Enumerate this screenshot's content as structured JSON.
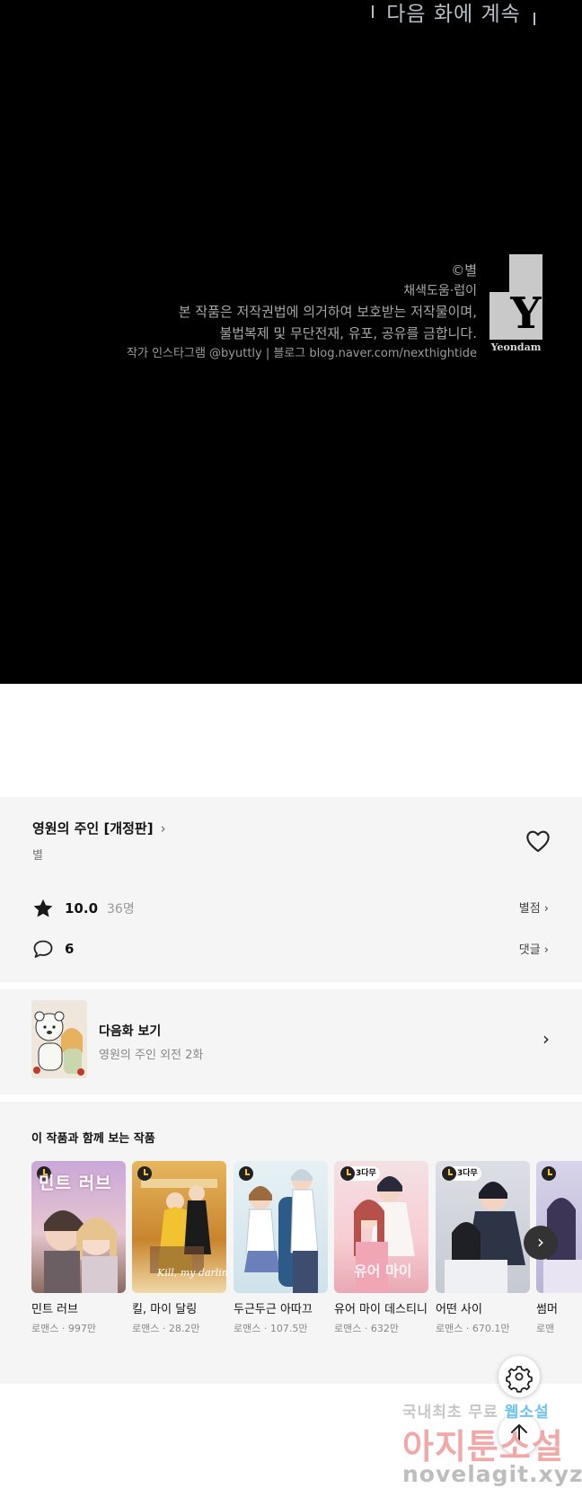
{
  "panel": {
    "next_caption": "다음 화에 계속",
    "credits": {
      "copyright": "©별",
      "assist": "채색도움·럽이",
      "notice_line1": "본 작품은 저작권법에 의거하여 보호받는 저작물이며,",
      "notice_line2": "불법복제 및 무단전재, 유포, 공유를 금합니다.",
      "sns_line": "작가 인스타그램  @byuttly | 블로그  blog.naver.com/nexthightide"
    },
    "logo_text": "Yeondam"
  },
  "work": {
    "title": "영원의 주인 [개정판]",
    "author": "별",
    "rating": "10.0",
    "rating_count": "36명",
    "rate_link": "별점",
    "comment_count": "6",
    "comment_link": "댓글"
  },
  "next_episode": {
    "label": "다음화 보기",
    "subtitle": "영원의 주인 외전 2화"
  },
  "recommendations": {
    "title": "이 작품과 함께 보는 작품",
    "items": [
      {
        "name": "민트 러브",
        "meta": "로맨스 · 997만",
        "cover_title": "민트 러브",
        "badge": ""
      },
      {
        "name": "킬, 마이 달링",
        "meta": "로맨스 · 28.2만",
        "cover_title": "",
        "badge": ""
      },
      {
        "name": "두근두근 아따끄",
        "meta": "로맨스 · 107.5만",
        "cover_title": "",
        "badge": ""
      },
      {
        "name": "유어 마이 데스티니",
        "meta": "로맨스 · 632만",
        "cover_title": "",
        "badge": "3다무"
      },
      {
        "name": "어떤 사이",
        "meta": "로맨스 · 670.1만",
        "cover_title": "",
        "badge": "3다무"
      },
      {
        "name": "썸머",
        "meta": "로맨",
        "cover_title": "",
        "badge": ""
      }
    ]
  },
  "watermark": {
    "line1_a": "국내최초 무료 ",
    "line1_b": "웹소설",
    "line2": "아지툰소설",
    "line3": "novelagit.xyz"
  },
  "colors": {
    "panel_bg": "#000000",
    "section_bg": "#f5f5f6",
    "caption": "#b9bec6"
  }
}
